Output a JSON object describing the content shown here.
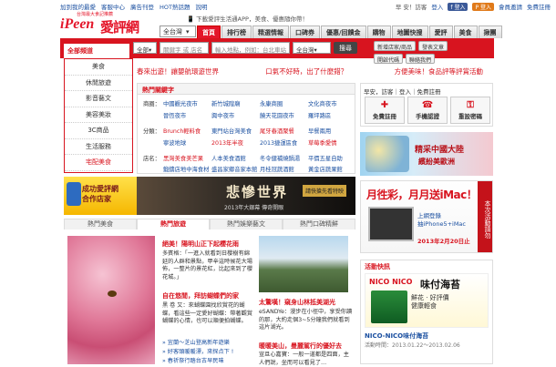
{
  "topbar": {
    "links": [
      "加到我的最愛",
      "客服中心",
      "廣告刊登",
      "HOT熱話題",
      "說明"
    ],
    "greeting": "早 安！訪客",
    "login": "登入",
    "facebook": "登入",
    "pb": "登入",
    "invite": "會員邀請",
    "free_reg": "免費註冊"
  },
  "logo": {
    "brand_en": "iPeen",
    "brand_zh": "愛評網",
    "tagline": "台灣最大食記推薦"
  },
  "promo": "下載愛評生活通APP，美食、優惠隨你帶！",
  "city_select": "全台灣",
  "nav_tabs": [
    "首頁",
    "排行榜",
    "精選情報",
    "口碑券",
    "優惠/回饋金",
    "購物",
    "地圖快搜",
    "愛評",
    "美食",
    "揪團"
  ],
  "search": {
    "all_categories": "全部頻道",
    "category_default": "全部",
    "keyword_placeholder": "關鍵字 或 店名",
    "place_placeholder": "輸入地點，例如：台北車站",
    "city": "全台灣",
    "button": "搜尋"
  },
  "right_buttons": [
    "新增店家/商品",
    "發表文章",
    "開啟代碼",
    "聯絡我們"
  ],
  "side_menu": [
    "美食",
    "休閒旅遊",
    "影音藝文",
    "美容美妝",
    "3C商品",
    "生活服務",
    "宅配美食"
  ],
  "slogans": [
    "春來出遊！讓嬰航環遊世界",
    "口氣不好時，出了什麼錯？",
    "方便美味！食品評等評賞活動"
  ],
  "hot_keywords": {
    "header": "熱門關鍵字",
    "rows": [
      {
        "label": "商圈：",
        "items": [
          "中國觀光夜市",
          "新竹城隍廟",
          "永康商圈",
          "文化商夜市"
        ]
      },
      {
        "label": "",
        "items": [
          "晉恆夜市",
          "興中夜市",
          "饒天花園夜市",
          "羅坪路區"
        ]
      },
      {
        "label": "分類：",
        "items": [
          "Brunch輕料食",
          "東門站台灣美食",
          "尾牙春酒聚餐",
          "早餐兩用"
        ]
      },
      {
        "label": "",
        "items": [
          "寧波地球",
          "2013年半夜",
          "2013捷運區食",
          "草莓季愛情"
        ]
      },
      {
        "label": "店名：",
        "items": [
          "黑灣美食美芒果",
          "人本美食酒館",
          "冬令健補燒鍋湯",
          "平價五星自助"
        ]
      },
      {
        "label": "",
        "items": [
          "鍛鑄店地中海食材",
          "盛昌家鄉音家本館",
          "月桂冠蔬酒館",
          "黃金店蔬果館"
        ]
      }
    ]
  },
  "login_box": {
    "text": "早安，訪客｜登入｜免費註冊",
    "buttons": [
      "免費註冊",
      "手機認證",
      "重設密碼"
    ]
  },
  "ad_china": {
    "title": "精采中國大陸",
    "sub": "繽紛美歐洲"
  },
  "ad_shop": {
    "text": "成功愛評網\n合作店家"
  },
  "ad_movie": {
    "title": "悲慘世界",
    "cta": "請快搶先看特映",
    "sub": "2013年大銀幕  傳奇開眼"
  },
  "ad_mac": {
    "title": "月徃彩，月月送iMac！",
    "sub": "上網登錄\n抽iPhone5+iMac",
    "date": "2013年2月20日止",
    "vbar": "本次活動請勿"
  },
  "content_tabs": [
    "熱門美食",
    "熱門旅遊",
    "熱門娛樂藝文",
    "熱門口碑精鮮"
  ],
  "article1": {
    "title": "絕美！陽明山正下起櫻花雨",
    "text": "多賓格：「一進入就看到日櫻樹有綿延的人群和景點，甲辛這時候花大場佈，一整片的景花紅，比起來到了櫻花城。」",
    "title2": "自在悠閒，拜訪蝴蝶們的家",
    "text2": "黑 卷 又：來蝴蝶園找欣賞花的蝴蝶，看這些一定愛好蝴蝶：帶著觀賞蝴蝶的心情，也可以順便拍蝴蝶。",
    "links": [
      "宜蘭～芝山登高新年遊樂",
      "好客頭暖暖漂，來探点下 !",
      "春祈祭行踏台古早民味"
    ]
  },
  "article2": {
    "title": "太驚嘆！窺身山林抵美湖光",
    "text": "eSANDYe：漫步在小徑中，享受你讀的那，大約走個3~5分鐘我們就看到這片湖光。",
    "title2": "暖暖美山，曼麗駕行的優好去",
    "text2": "宣旦心嘉寶：一般一道都是四面，主人們說，坐而可以看見了…"
  },
  "activity": {
    "header": "活動快訊",
    "brand": "NICO NICO",
    "product": "味付海苔",
    "desc": "鮮花 · 好評價\n健康輕食",
    "caption": "NICO-NICO味付海苔",
    "date": "活動時間：2013.01.22～2013.02.06"
  }
}
